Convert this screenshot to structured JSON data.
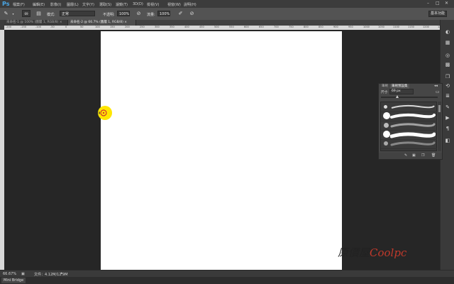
{
  "app": {
    "logo": "Ps"
  },
  "menu": {
    "items": [
      "檔案(F)",
      "編輯(E)",
      "影像(I)",
      "圖層(L)",
      "文字(Y)",
      "選取(S)",
      "濾鏡(T)",
      "3D(D)",
      "檢視(V)",
      "視窗(W)",
      "說明(H)"
    ]
  },
  "window_controls": {
    "minimize": "–",
    "maximize": "□",
    "close": "✕"
  },
  "options": {
    "brush_size": "69",
    "mode_label": "模式:",
    "mode_value": "正常",
    "opacity_label": "不透明:",
    "opacity_value": "100%",
    "flow_label": "流量:",
    "flow_value": "100%",
    "workspace": "基本功能"
  },
  "tabs": [
    {
      "label": "未命名-1 @ 100% (圖層 1, RGB/8) ×",
      "active": false
    },
    {
      "label": "未命名-2 @ 66.7% (圖層 1, RGB/8) ×",
      "active": true
    }
  ],
  "ruler": {
    "top_ticks": [
      "-200",
      "-150",
      "-100",
      "-50",
      "0",
      "50",
      "100",
      "150",
      "200",
      "250",
      "300",
      "350",
      "400",
      "450",
      "500",
      "550",
      "600",
      "650",
      "700",
      "750",
      "800",
      "850",
      "900",
      "950",
      "1000",
      "1050",
      "1100",
      "1150",
      "1200",
      "1250"
    ]
  },
  "brush_panel": {
    "tabs": [
      "筆刷",
      "筆刷預設集"
    ],
    "size_label": "尺寸:",
    "size_value": "69 px",
    "presets": [
      {
        "dot": 5
      },
      {
        "dot": 10
      },
      {
        "dot": 7
      },
      {
        "dot": 10
      },
      {
        "dot": 6
      }
    ]
  },
  "status": {
    "zoom": "66.67%",
    "doc_info": "文件：4.12M/12.9M"
  },
  "minibridge": {
    "label": "Mini Bridge"
  },
  "watermark": {
    "text_a": "原價屋",
    "text_b": "Coolpc"
  },
  "colors": {
    "accent": "#4aa7e6",
    "cursor": "#ffe600",
    "watermark_accent": "#c0392b"
  }
}
